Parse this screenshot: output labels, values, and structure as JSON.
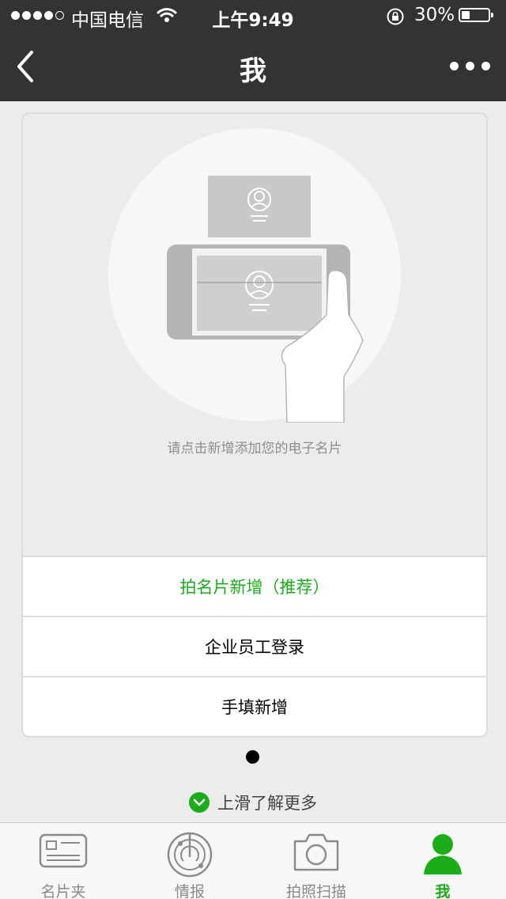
{
  "status_bar": {
    "carrier": "中国电信",
    "time": "上午9:49",
    "battery_percent": "30%",
    "battery_level": 0.3,
    "signal_bars_filled": 4,
    "signal_bars_total": 5,
    "icons": [
      "wifi-icon",
      "orientation-lock-icon",
      "battery-icon"
    ]
  },
  "nav": {
    "title": "我",
    "back_icon": "chevron-left-icon",
    "more_icon": "more-dots-icon"
  },
  "card": {
    "hint": "请点击新增添加您的电子名片",
    "actions": [
      {
        "label": "拍名片新增（推荐）",
        "primary": true
      },
      {
        "label": "企业员工登录",
        "primary": false
      },
      {
        "label": "手填新增",
        "primary": false
      }
    ]
  },
  "pager": {
    "pages": 1,
    "current": 1
  },
  "swipe_hint": {
    "text": "上滑了解更多",
    "icon": "chevron-down-circle-icon"
  },
  "tabs": [
    {
      "label": "名片夹",
      "icon": "card-holder-icon",
      "active": false
    },
    {
      "label": "情报",
      "icon": "radar-icon",
      "active": false
    },
    {
      "label": "拍照扫描",
      "icon": "camera-icon",
      "active": false
    },
    {
      "label": "我",
      "icon": "person-icon",
      "active": true
    }
  ],
  "colors": {
    "accent": "#1aad19",
    "bar_bg": "#333335",
    "page_bg": "#ececec"
  }
}
